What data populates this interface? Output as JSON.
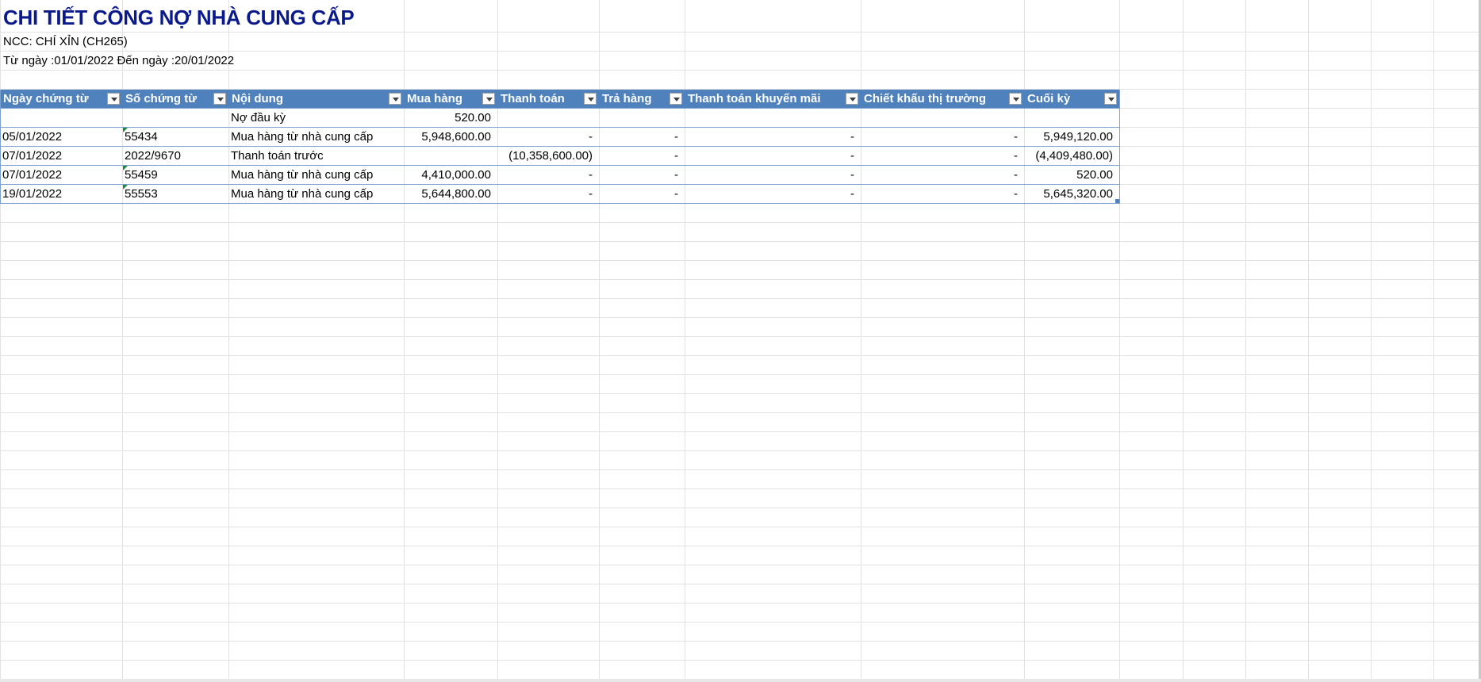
{
  "report": {
    "title": "CHI TIẾT CÔNG NỢ NHÀ CUNG CẤP",
    "supplier": "NCC: CHÍ XỈN (CH265)",
    "date_range": "Từ ngày :01/01/2022 Đến ngày :20/01/2022"
  },
  "table": {
    "headers": [
      "Ngày chứng từ",
      "Số chứng từ",
      "Nội dung",
      "Mua hàng",
      "Thanh toán",
      "Trả hàng",
      "Thanh toán khuyến mãi",
      "Chiết khấu thị trường",
      "Cuối kỳ"
    ],
    "rows": [
      [
        "",
        "",
        "Nợ đầu kỳ",
        "520.00",
        "",
        "",
        "",
        "",
        ""
      ],
      [
        "05/01/2022",
        "55434",
        "Mua hàng từ nhà cung cấp",
        "5,948,600.00",
        "-",
        "-",
        "-",
        "-",
        "5,949,120.00"
      ],
      [
        "07/01/2022",
        "2022/9670",
        "Thanh toán trước",
        "",
        "(10,358,600.00)",
        "-",
        "-",
        "-",
        "(4,409,480.00)"
      ],
      [
        "07/01/2022",
        "55459",
        "Mua hàng từ nhà cung cấp",
        "4,410,000.00",
        "-",
        "-",
        "-",
        "-",
        "520.00"
      ],
      [
        "19/01/2022",
        "55553",
        "Mua hàng từ nhà cung cấp",
        "5,644,800.00",
        "-",
        "-",
        "-",
        "-",
        "5,645,320.00"
      ]
    ]
  },
  "colors": {
    "title": "#0b1a8a",
    "header_bg": "#4f81bd",
    "header_text": "#ffffff",
    "error_indicator": "#1e8c3a"
  }
}
